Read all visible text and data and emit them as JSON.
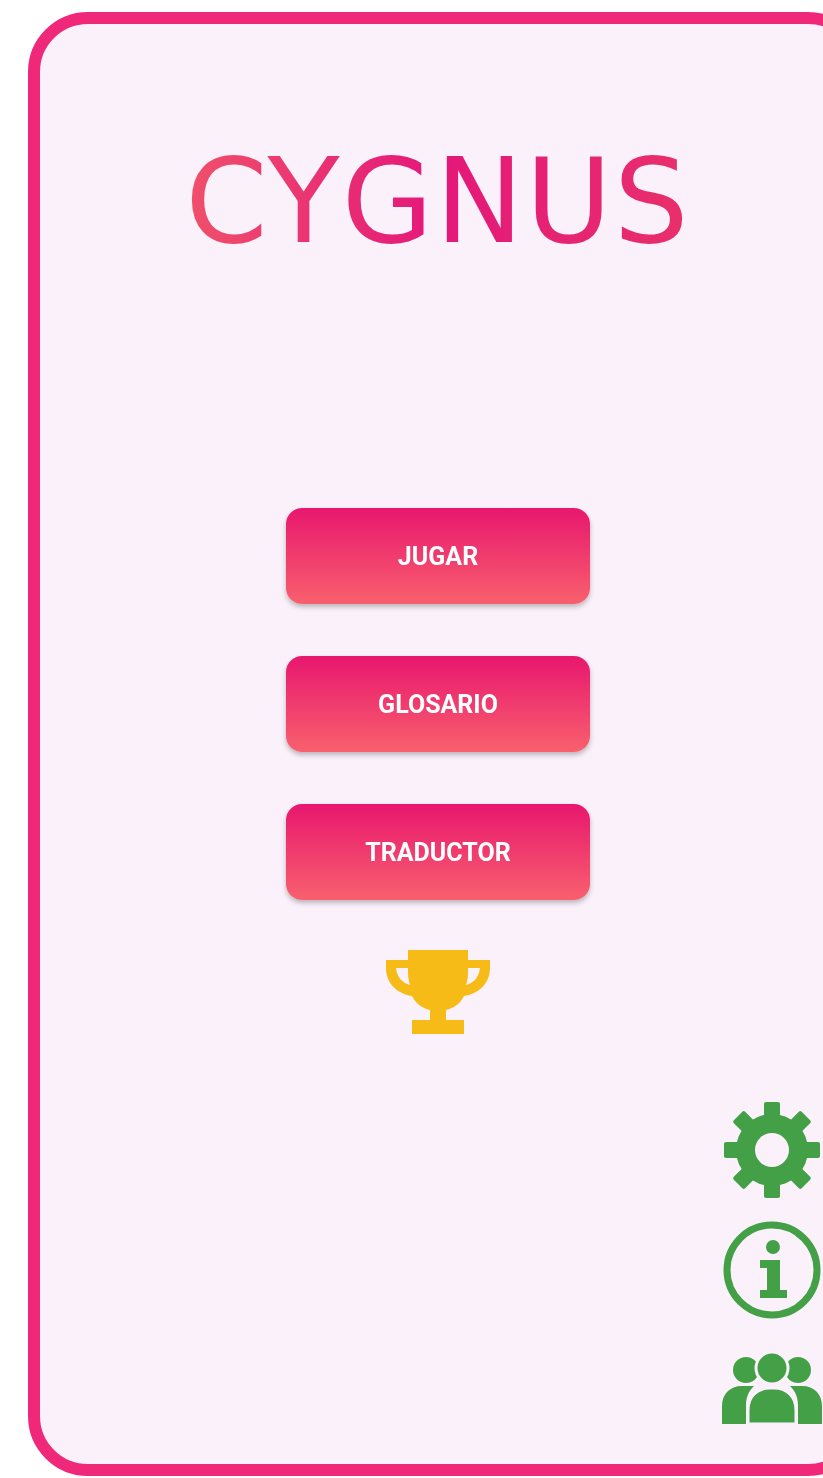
{
  "logo": "CYGNUS",
  "menu_buttons": [
    {
      "label": "JUGAR"
    },
    {
      "label": "GLOSARIO"
    },
    {
      "label": "TRADUCTOR"
    }
  ]
}
